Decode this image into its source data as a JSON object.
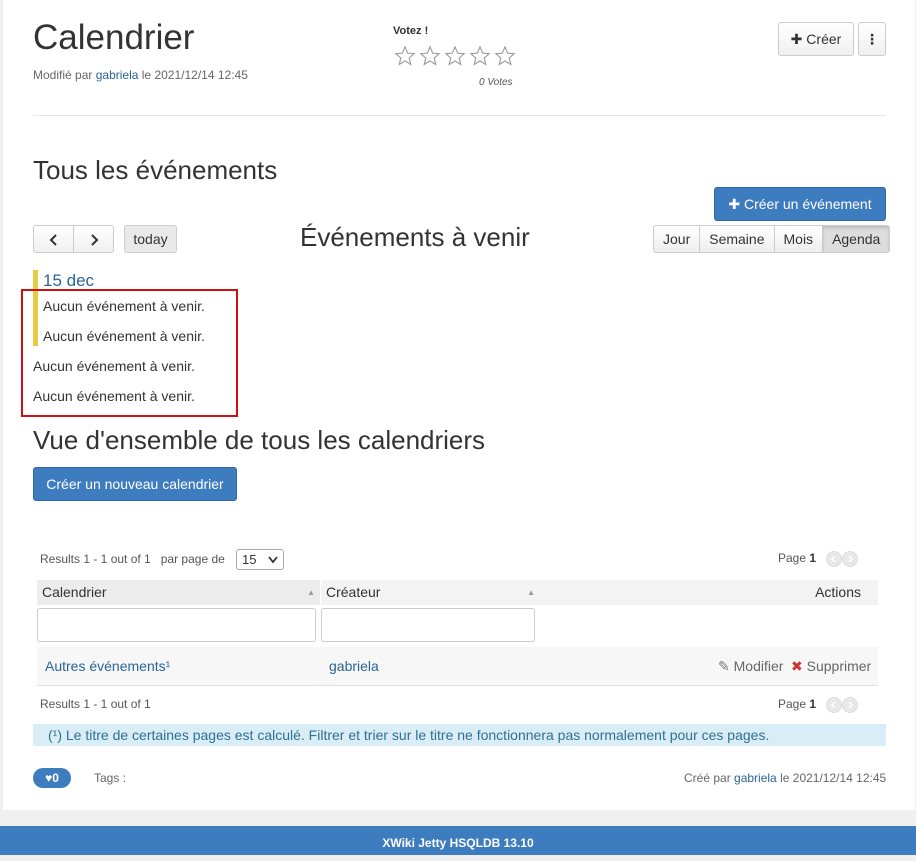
{
  "header": {
    "title": "Calendrier",
    "modified_prefix": "Modifié par",
    "modified_user": "gabriela",
    "modified_date_prefix": "le",
    "modified_date": "2021/12/14 12:45",
    "vote_label": "Votez !",
    "votes_count": "0 Votes",
    "rating": 0,
    "rating_max": 5,
    "create_button": "Créer"
  },
  "events": {
    "section_title": "Tous les événements",
    "create_event_button": "Créer un événement",
    "today_button": "today",
    "view_title": "Événements à venir",
    "views": [
      "Jour",
      "Semaine",
      "Mois",
      "Agenda"
    ],
    "active_view": "Agenda",
    "date_label": "15 dec",
    "empty_messages": [
      "Aucun événement à venir.",
      "Aucun événement à venir.",
      "Aucun événement à venir.",
      "Aucun événement à venir."
    ]
  },
  "overview": {
    "section_title": "Vue d'ensemble de tous les calendriers",
    "new_calendar_button": "Créer un nouveau calendrier",
    "results_top": "Results 1 - 1 out of 1",
    "per_page_label": "par page de",
    "per_page_value": "15",
    "page_label": "Page",
    "page_number": "1",
    "columns": [
      "Calendrier",
      "Créateur",
      "Actions"
    ],
    "rows": [
      {
        "calendar": "Autres événements¹",
        "creator": "gabriela",
        "edit": "Modifier",
        "delete": "Supprimer"
      }
    ],
    "results_bottom": "Results 1 - 1 out of 1",
    "note": "(¹) Le titre de certaines pages est calculé. Filtrer et trier sur le titre ne fonctionnera pas normalement pour ces pages."
  },
  "footer": {
    "likes": "0",
    "tags_label": "Tags :",
    "created_prefix": "Créé par",
    "created_user": "gabriela",
    "created_date_prefix": "le",
    "created_date": "2021/12/14 12:45",
    "bar_text": "XWiki Jetty HSQLDB 13.10"
  },
  "colors": {
    "primary": "#3e7cc0",
    "link": "#2a6496",
    "highlight_box": "#cc1111",
    "event_marker": "#e6cc44",
    "footer_bar": "#3e7cc0"
  }
}
